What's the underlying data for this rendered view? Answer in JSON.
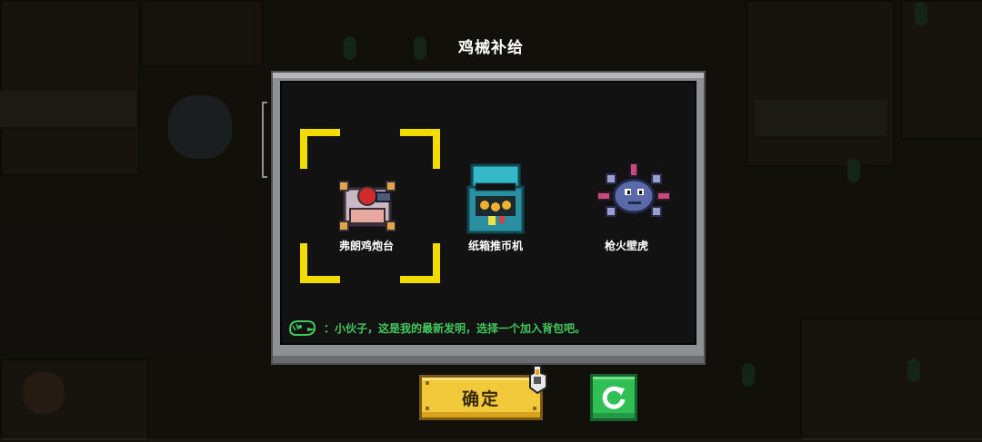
{
  "dialog": {
    "title": "鸡械补给",
    "items": [
      {
        "label": "弗朗鸡炮台",
        "icon": "chicken-cannon-turret-icon",
        "selected": true
      },
      {
        "label": "纸箱推币机",
        "icon": "cardboard-coin-pusher-icon",
        "selected": false
      },
      {
        "label": "枪火壁虎",
        "icon": "gunfire-gecko-icon",
        "selected": false
      }
    ],
    "message": "：小伙子，这是我的最新发明，选择一个加入背包吧。",
    "speaker_icon": "chicken-head-icon"
  },
  "buttons": {
    "confirm_label": "确定",
    "refresh_icon": "refresh-icon"
  },
  "colors": {
    "selection": "#f2dc00",
    "message_text": "#41c85a",
    "confirm_button": "#f2c93a",
    "refresh_button": "#2fbf55"
  }
}
